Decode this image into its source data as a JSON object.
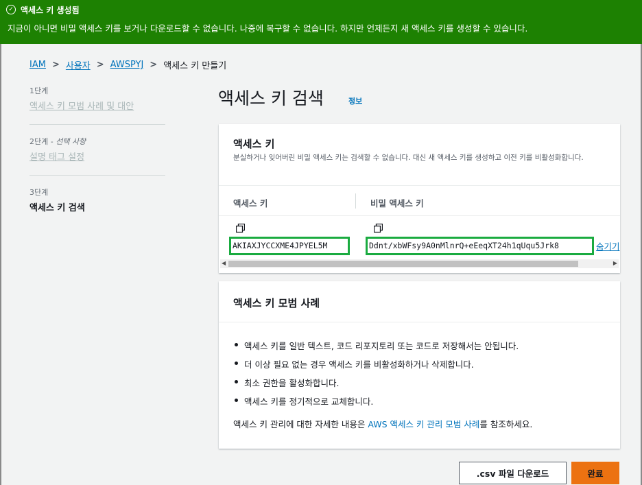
{
  "banner": {
    "title": "액세스 키 생성됨",
    "message": "지금이 아니면 비밀 액세스 키를 보거나 다운로드할 수 없습니다. 나중에 복구할 수 없습니다. 하지만 언제든지 새 액세스 키를 생성할 수 있습니다.",
    "color": "#1d8102",
    "icon": "check-circle-icon"
  },
  "breadcrumb": {
    "items": [
      "IAM",
      "사용자",
      "AWSPYJ"
    ],
    "current": "액세스 키 만들기"
  },
  "steps": [
    {
      "label": "1단계",
      "optional": "",
      "name": "액세스 키 모범 사례 및 대안"
    },
    {
      "label": "2단계 - ",
      "optional": "선택 사항",
      "name": "설명 태그 설정"
    },
    {
      "label": "3단계",
      "optional": "",
      "name": "액세스 키 검색"
    }
  ],
  "page": {
    "title": "액세스 키 검색",
    "info_link": "정보"
  },
  "access_key_panel": {
    "title": "액세스 키",
    "description": "분실하거나 잊어버린 비밀 액세스 키는 검색할 수 없습니다. 대신 새 액세스 키를 생성하고 이전 키를 비활성화합니다.",
    "col_access_key": "액세스 키",
    "col_secret_key": "비밀 액세스 키",
    "access_key_value": "AKIAXJYCCXME4JPYEL5M",
    "secret_key_value": "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",
    "hide_link": "숨기기",
    "highlight_color": "#1aab40"
  },
  "best_practices_panel": {
    "title": "액세스 키 모범 사례",
    "items": [
      "액세스 키를 일반 텍스트, 코드 리포지토리 또는 코드로 저장해서는 안됩니다.",
      "더 이상 필요 없는 경우 액세스 키를 비활성화하거나 삭제합니다.",
      "최소 권한을 활성화합니다.",
      "액세스 키를 정기적으로 교체합니다."
    ],
    "footer_prefix": "액세스 키 관리에 대한 자세한 내용은 ",
    "footer_link": "AWS 액세스 키 관리 모범 사례",
    "footer_suffix": "를 참조하세요."
  },
  "actions": {
    "csv_download": ".csv 파일 다운로드",
    "done": "완료",
    "done_color": "#ec7211"
  }
}
